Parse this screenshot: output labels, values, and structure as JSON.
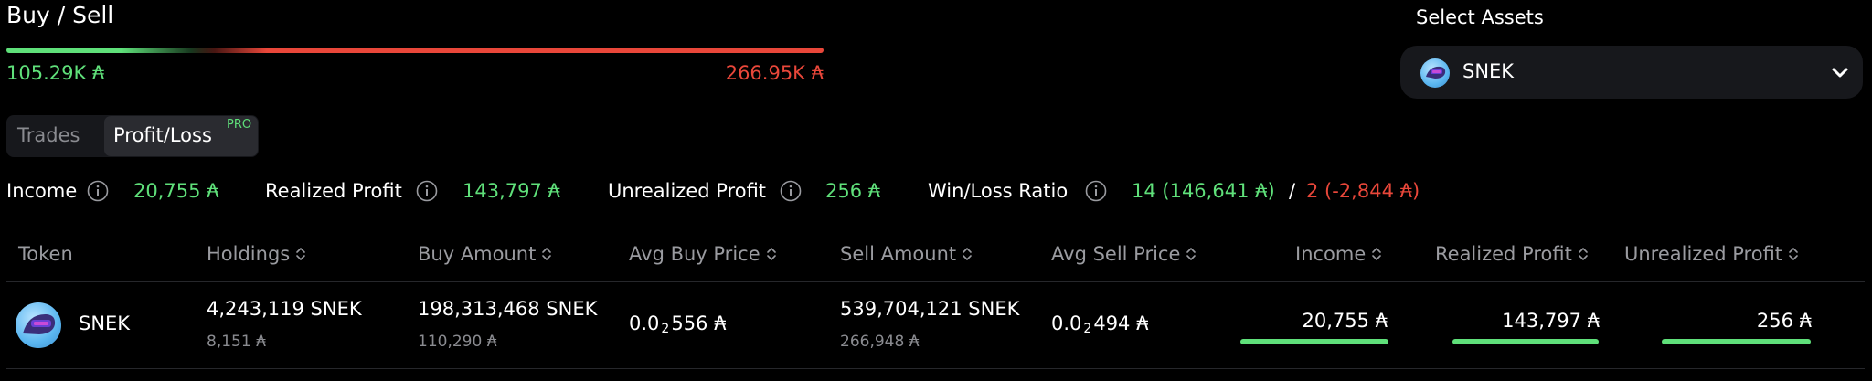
{
  "buy_sell": {
    "title": "Buy / Sell",
    "buy_amount": "105.29K ₳",
    "sell_amount": "266.95K ₳",
    "buy_fraction": 0.283
  },
  "select_assets": {
    "label": "Select Assets",
    "selected": "SNEK",
    "icon": "chevron-down-icon"
  },
  "tabs": {
    "trades": "Trades",
    "profit_loss": "Profit/Loss",
    "pro_badge": "PRO",
    "active": "Profit/Loss"
  },
  "stats": {
    "income_label": "Income",
    "income_value": "20,755 ₳",
    "realized_label": "Realized Profit",
    "realized_value": "143,797 ₳",
    "unrealized_label": "Unrealized Profit",
    "unrealized_value": "256 ₳",
    "winloss_label": "Win/Loss Ratio",
    "win_value": "14 (146,641 ₳)",
    "separator": "/",
    "loss_value": "2 (-2,844 ₳)"
  },
  "table": {
    "headers": {
      "token": "Token",
      "holdings": "Holdings",
      "buy_amount": "Buy Amount",
      "avg_buy_price": "Avg Buy Price",
      "sell_amount": "Sell Amount",
      "avg_sell_price": "Avg Sell Price",
      "income": "Income",
      "realized_profit": "Realized Profit",
      "unrealized_profit": "Unrealized Profit"
    },
    "rows": [
      {
        "token": "SNEK",
        "holdings": "4,243,119 SNEK",
        "holdings_ada": "8,151 ₳",
        "buy_amount": "198,313,468 SNEK",
        "buy_amount_ada": "110,290 ₳",
        "avg_buy_prefix": "0.0",
        "avg_buy_zeros": "2",
        "avg_buy_suffix": "556 ₳",
        "sell_amount": "539,704,121 SNEK",
        "sell_amount_ada": "266,948 ₳",
        "avg_sell_prefix": "0.0",
        "avg_sell_zeros": "2",
        "avg_sell_suffix": "494 ₳",
        "income": "20,755 ₳",
        "realized_profit": "143,797 ₳",
        "unrealized_profit": "256 ₳"
      }
    ]
  },
  "colors": {
    "positive": "#5fe07a",
    "negative": "#e9473a",
    "background": "#000000"
  }
}
